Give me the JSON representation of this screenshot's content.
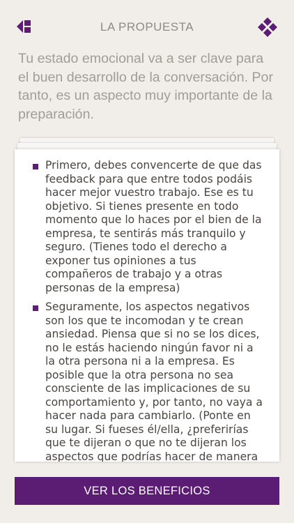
{
  "header": {
    "title": "LA PROPUESTA",
    "back_icon": "back-arrow-icon",
    "menu_icon": "four-diamonds-icon"
  },
  "intro": "Tu estado emocional va a ser clave para el buen desarrollo de la conversación. Por tanto, es un aspecto muy importante de la preparación.",
  "card": {
    "items": [
      "Primero, debes convencerte de que das feedback para que entre todos podáis hacer mejor vuestro trabajo. Ese es tu objetivo. Si tienes presente en todo momento que lo haces por el bien de la empresa, te sentirás más tranquilo y seguro.  (Tienes todo el derecho a exponer tus opiniones a tus compañeros de trabajo y a otras personas de la empresa)",
      "Seguramente, los aspectos negativos son los que te incomodan y te crean ansiedad. Piensa que si no se los dices, no le estás haciendo ningún favor ni a la otra persona ni a la empresa. Es posible que la otra persona no sea consciente de las implicaciones de su comportamiento y, por tanto, no vaya a hacer nada para cambiarlo. (Ponte en su lugar. Si fueses él/ella, ¿preferirías que te dijeran o que no te dijeran los aspectos que podrías hacer de manera"
    ]
  },
  "cta_label": "VER LOS BENEFICIOS",
  "colors": {
    "accent": "#5b1c73",
    "background": "#f1eeea",
    "text_muted": "#a19c96",
    "text_body": "#4a4540"
  }
}
